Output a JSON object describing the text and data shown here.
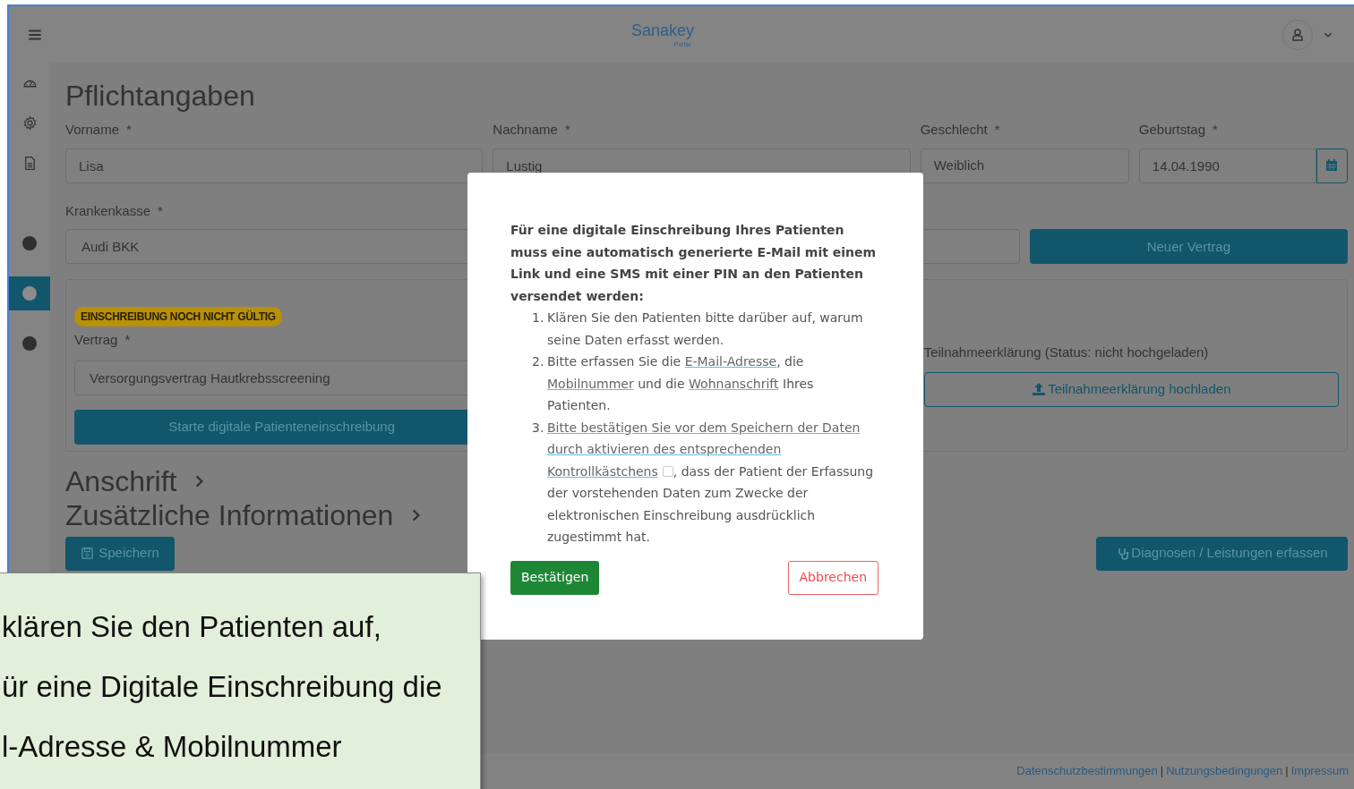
{
  "header": {
    "logo": "Sanakey",
    "logo_sub": "Portal"
  },
  "sidebar": {
    "icons": [
      {
        "kind": "dashboard"
      },
      {
        "kind": "settings"
      },
      {
        "kind": "document"
      }
    ],
    "steps": [
      {
        "selected": false
      },
      {
        "selected": true
      },
      {
        "selected": false
      }
    ]
  },
  "form": {
    "title": "Pflichtangaben",
    "fields": [
      {
        "label": "Vorname",
        "mark": "*",
        "kind": "text",
        "value": "Lisa"
      },
      {
        "label": "Nachname",
        "mark": "*",
        "kind": "text",
        "value": "Lustig"
      },
      {
        "label": "Geschlecht",
        "mark": "*",
        "kind": "select",
        "value": "Weiblich"
      },
      {
        "label": "Geburtstag",
        "mark": "*",
        "kind": "date",
        "value": "14.04.1990"
      }
    ],
    "insurance": {
      "label": "Krankenkasse",
      "mark": "*",
      "value": "Audi BKK"
    },
    "new_contract_button": "Neuer Vertrag"
  },
  "contract": {
    "badge": "EINSCHREIBUNG NOCH NICHT GÜLTIG",
    "label": "Vertrag",
    "mark": "*",
    "value": "Versorgungsvertrag Hautkrebsscreening",
    "start_button": "Starte digitale Patienteneinschreibung",
    "declaration_label": "Teilnahmeerklärung (Status: nicht hochgeladen)",
    "upload_button": "Teilnahmeerklärung hochladen"
  },
  "sections": [
    {
      "title": "Anschrift",
      "expanded": false
    },
    {
      "title": "Zusätzliche Informationen",
      "expanded": false
    }
  ],
  "save_button": "Speichern",
  "diagnoses_button": "Diagnosen / Leistungen erfassen",
  "footer": [
    {
      "kind": "link",
      "text": "Datenschutzbestimmungen"
    },
    {
      "kind": "separator",
      "text": "|"
    },
    {
      "kind": "link",
      "text": "Nutzungsbedingungen"
    },
    {
      "kind": "separator",
      "text": "|"
    },
    {
      "kind": "link",
      "text": "Impressum"
    }
  ],
  "modal": {
    "intro": "Für eine digitale Einschreibung Ihres Patienten muss eine automatisch generierte E-Mail mit einem Link und eine SMS mit einer PIN an den Patienten versendet werden:",
    "items": [
      {
        "number": "1.",
        "parts": [
          {
            "kind": "text",
            "text": "Klären Sie den Patienten bitte darüber auf, warum seine Daten erfasst werden."
          }
        ]
      },
      {
        "number": "2.",
        "parts": [
          {
            "kind": "text",
            "text": "Bitte erfassen Sie die "
          },
          {
            "kind": "link",
            "text": "E-Mail-Adresse"
          },
          {
            "kind": "text",
            "text": ", die "
          },
          {
            "kind": "link",
            "text": "Mobilnummer"
          },
          {
            "kind": "text",
            "text": " und die "
          },
          {
            "kind": "link",
            "text": "Wohnanschrift"
          },
          {
            "kind": "text",
            "text": " Ihres Patienten."
          }
        ]
      },
      {
        "number": "3.",
        "parts": [
          {
            "kind": "link",
            "text": "Bitte bestätigen Sie vor dem Speichern der Daten"
          },
          {
            "kind": "link",
            "text": "durch aktivieren des entsprechenden"
          },
          {
            "kind": "link",
            "text": "Kontrollkästchens"
          },
          {
            "kind": "checkbox",
            "checked": false
          },
          {
            "kind": "text",
            "text": ", dass der Patient der Erfassung der vorstehenden Daten zum Zwecke der elektronischen Einschreibung ausdrücklich zugestimmt hat."
          }
        ]
      }
    ],
    "confirm_button": "Bestätigen",
    "cancel_button": "Abbrechen"
  },
  "callout": {
    "lines": [
      "klären Sie den Patienten auf,",
      "ür eine Digitale Einschreibung die",
      "l-Adresse & Mobilnummer"
    ]
  }
}
